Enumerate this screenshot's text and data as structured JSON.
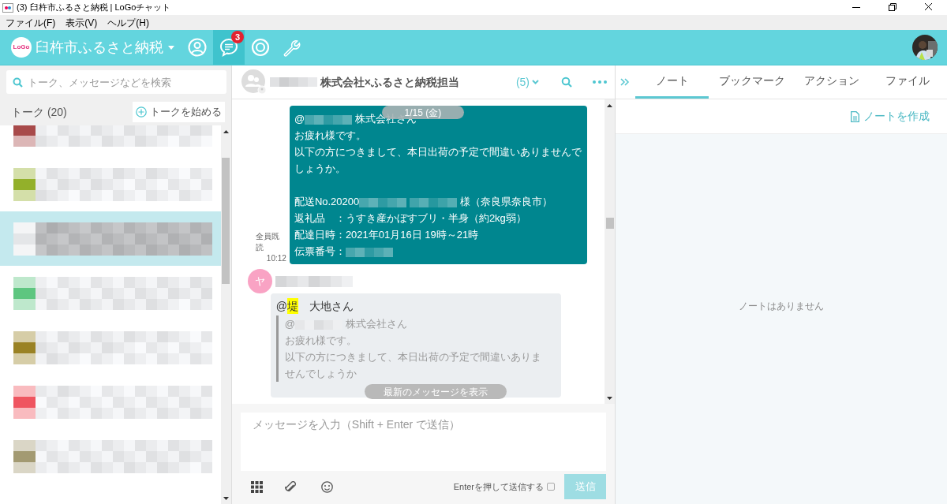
{
  "window": {
    "title": "(3) 臼杵市ふるさと納税 | LoGoチャット"
  },
  "menu": [
    "ファイル(F)",
    "表示(V)",
    "ヘルプ(H)"
  ],
  "header": {
    "logo": "LoGo",
    "workspace": "臼杵市ふるさと納税",
    "nav": [
      {
        "kind": "person",
        "selected": false
      },
      {
        "kind": "chat",
        "selected": true,
        "badge": "3"
      },
      {
        "kind": "target",
        "selected": false
      },
      {
        "kind": "wrench",
        "selected": false
      }
    ]
  },
  "sidebar": {
    "search_placeholder": "トーク、メッセージなどを検索",
    "title": "トーク (20)",
    "new_talk": "トークを始める",
    "items": [
      {
        "color": "#a84a4a",
        "selected": false
      },
      {
        "color": "#93b02a",
        "selected": false
      },
      {
        "color": "#e4e6e8",
        "selected": true
      },
      {
        "color": "#5ec680",
        "selected": false
      },
      {
        "color": "#9a8224",
        "selected": false
      },
      {
        "color": "#ef5560",
        "selected": false
      },
      {
        "color": "#a39a72",
        "selected": false
      }
    ]
  },
  "chat": {
    "title_parts": [
      {
        "kind": "redacted"
      },
      {
        "kind": "text",
        "text": "株式会社×ふるさと納税担当"
      }
    ],
    "members": "(5)",
    "date": "1/15 (金)",
    "messages": [
      {
        "kind": "outgoing",
        "read": "全員既読",
        "time": "10:12",
        "lines": [
          {
            "parts": [
              {
                "kind": "text",
                "text": "@"
              },
              {
                "kind": "redacted"
              },
              {
                "kind": "text",
                "text": "株式会社さん"
              }
            ]
          },
          {
            "parts": [
              {
                "kind": "text",
                "text": "お疲れ様です。"
              }
            ]
          },
          {
            "parts": [
              {
                "kind": "text",
                "text": "以下の方につきまして、本日出荷の予定で間違いありませんでしょうか。"
              }
            ]
          },
          {
            "space_before": true,
            "parts": [
              {
                "kind": "text",
                "text": "配送No.20200"
              },
              {
                "kind": "redacted"
              },
              {
                "kind": "redacted"
              },
              {
                "kind": "text",
                "text": "様（奈良県奈良市）"
              }
            ]
          },
          {
            "parts": [
              {
                "kind": "text",
                "text": "返礼品　：うすき産かぼすブリ・半身（約2kg弱）"
              }
            ]
          },
          {
            "parts": [
              {
                "kind": "text",
                "text": "配達日時：2021年01月16日 19時～21時"
              }
            ]
          },
          {
            "parts": [
              {
                "kind": "text",
                "text": "伝票番号："
              },
              {
                "kind": "redacted"
              }
            ]
          }
        ]
      },
      {
        "kind": "incoming",
        "avatar": "ヤ",
        "mention": [
          {
            "kind": "text",
            "text": "@"
          },
          {
            "kind": "text",
            "text": "堤",
            "highlight": true
          },
          {
            "kind": "text",
            "text": "　大地さん"
          }
        ],
        "quote": [
          {
            "parts": [
              {
                "kind": "text",
                "text": "@"
              },
              {
                "kind": "redacted"
              },
              {
                "kind": "text",
                "text": "株式会社さん"
              }
            ]
          },
          {
            "parts": [
              {
                "kind": "text",
                "text": "お疲れ様です。"
              }
            ]
          },
          {
            "parts": [
              {
                "kind": "text",
                "text": "以下の方につきまして、本日出荷の予定で間違いありませんでしょうか"
              }
            ]
          }
        ]
      }
    ],
    "latest_button": "最新のメッセージを表示",
    "composer": {
      "placeholder": "メッセージを入力（Shift + Enter で送信）",
      "enter_label": "Enterを押して送信する",
      "enter_checked": false,
      "send": "送信",
      "send_disabled": true
    }
  },
  "panel": {
    "tabs": [
      {
        "label": "ノート",
        "selected": true
      },
      {
        "label": "ブックマーク",
        "selected": false
      },
      {
        "label": "アクション",
        "selected": false
      },
      {
        "label": "ファイル",
        "selected": false
      }
    ],
    "create": "ノートを作成",
    "empty": "ノートはありません"
  }
}
